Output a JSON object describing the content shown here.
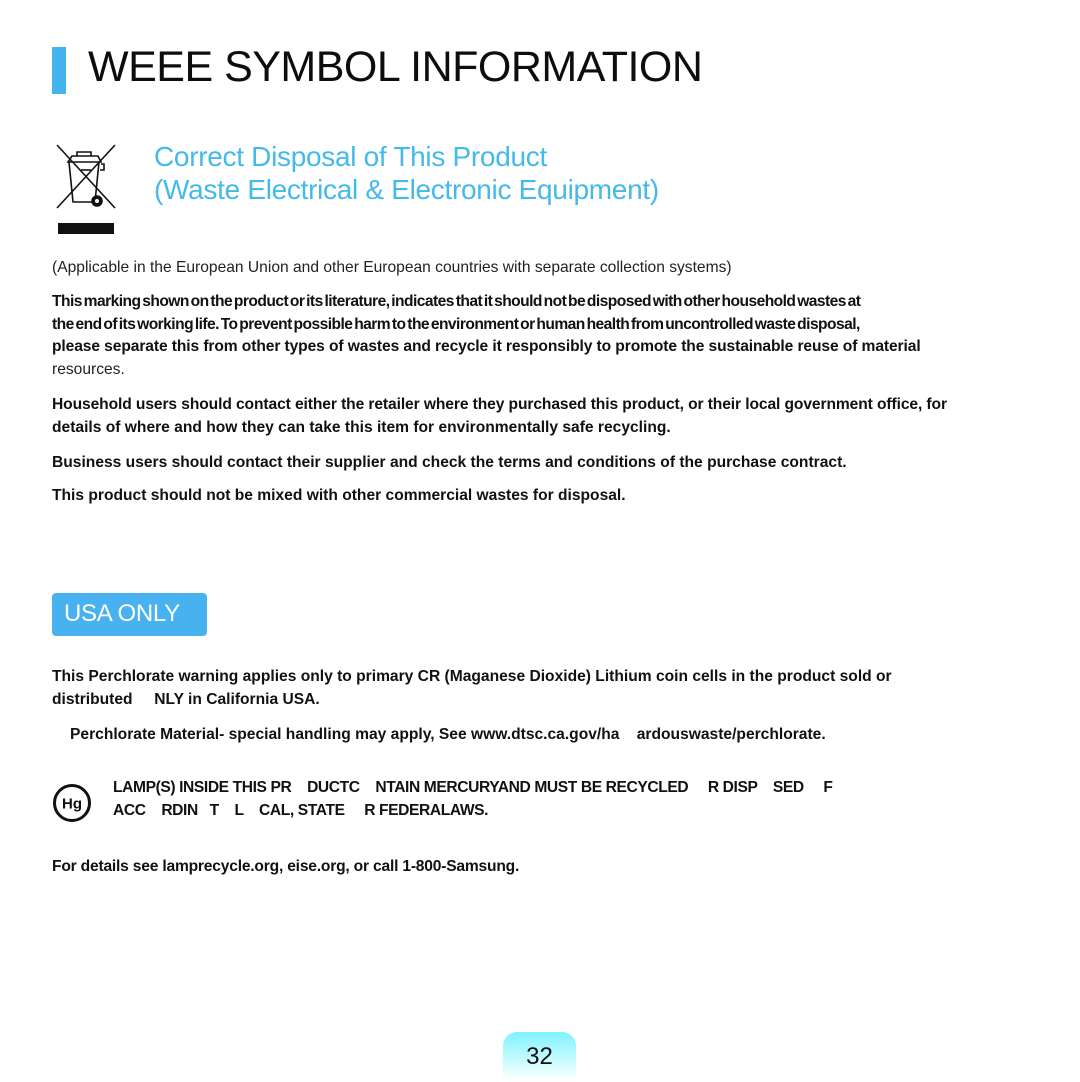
{
  "header": {
    "title": "WEEE SYMBOL INFORMATION",
    "accent_color": "#45b3ee"
  },
  "weee_section": {
    "icon": "crossed-out-wheelie-bin-icon",
    "subtitle_lines": [
      "Correct Disposal of This Product",
      "(Waste Electrical & Electronic Equipment)"
    ],
    "subtitle_color": "#45b9ea",
    "applicability_note": "(Applicable in the European Union and other European countries with separate collection systems)",
    "marking_paragraph_lines": [
      "This marking shown on the product or its literature, indicates that it should not be disposed with other household wastes at",
      "the end of its working life. To prevent possible harm to the environment or human health from uncontrolled waste disposal,",
      "please separate this from other types of wastes and recycle it responsibly to promote the sustainable reuse of material",
      "resources."
    ],
    "household_paragraph_lines": [
      "Household users should contact either the retailer where they purchased this product, or their local government office, for",
      "details of where and how they can take this item for environmentally safe recycling."
    ],
    "business_paragraph": "Business users should contact their supplier and check the terms and conditions of the purchase contract.",
    "commercial_paragraph": "This product should not be mixed with other commercial wastes for disposal."
  },
  "usa_section": {
    "badge_label": "USA ONLY",
    "badge_color": "#47b2ef",
    "perchlorate_lines": [
      "This Perchlorate warning applies only to primary CR (Maganese Dioxide) Lithium coin cells in the product sold or",
      "distributed     NLY in California USA."
    ],
    "perchlorate_material": "Perchlorate Material- special handling may apply, See www.dtsc.ca.gov/ha    ardouswaste/perchlorate.",
    "hg_icon_label": "Hg",
    "mercury_lines": [
      "LAMP(S) INSIDE THIS PR    DUCTC    NTAIN MERCURYAND MUST BE RECYCLED     R DISP    SED     F",
      "ACC    RDIN   T    L    CAL, STATE     R FEDERALAWS."
    ],
    "details_line": "For details see lamprecycle.org, eise.org, or call 1-800-Samsung."
  },
  "footer": {
    "page_number": "32"
  }
}
